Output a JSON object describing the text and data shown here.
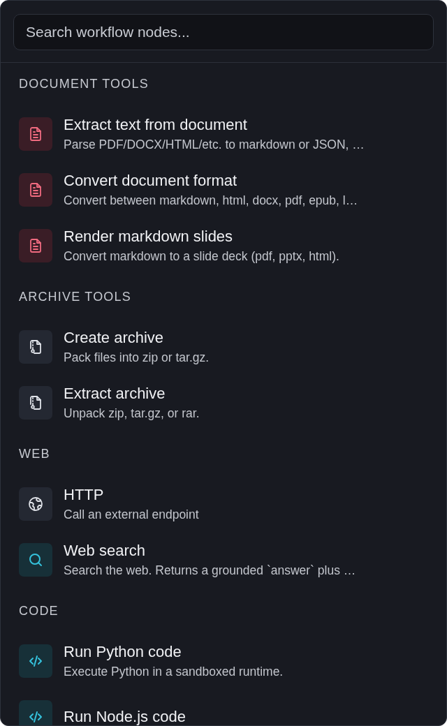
{
  "search": {
    "placeholder": "Search workflow nodes..."
  },
  "sections": [
    {
      "title": "DOCUMENT TOOLS",
      "items": [
        {
          "kind": "document",
          "title": "Extract text from document",
          "description": "Parse PDF/DOCX/HTML/etc. to markdown or JSON, …"
        },
        {
          "kind": "document",
          "title": "Convert document format",
          "description": "Convert between markdown, html, docx, pdf, epub, l…"
        },
        {
          "kind": "document",
          "title": "Render markdown slides",
          "description": "Convert markdown to a slide deck (pdf, pptx, html)."
        }
      ]
    },
    {
      "title": "ARCHIVE TOOLS",
      "items": [
        {
          "kind": "archive",
          "title": "Create archive",
          "description": "Pack files into zip or tar.gz."
        },
        {
          "kind": "archive",
          "title": "Extract archive",
          "description": "Unpack zip, tar.gz, or rar."
        }
      ]
    },
    {
      "title": "WEB",
      "items": [
        {
          "kind": "globe",
          "title": "HTTP",
          "description": "Call an external endpoint"
        },
        {
          "kind": "search",
          "title": "Web search",
          "description": "Search the web. Returns a grounded `answer` plus …"
        }
      ]
    },
    {
      "title": "CODE",
      "items": [
        {
          "kind": "code",
          "title": "Run Python code",
          "description": "Execute Python in a sandboxed runtime."
        },
        {
          "kind": "code",
          "title": "Run Node.js code"
        }
      ]
    }
  ]
}
